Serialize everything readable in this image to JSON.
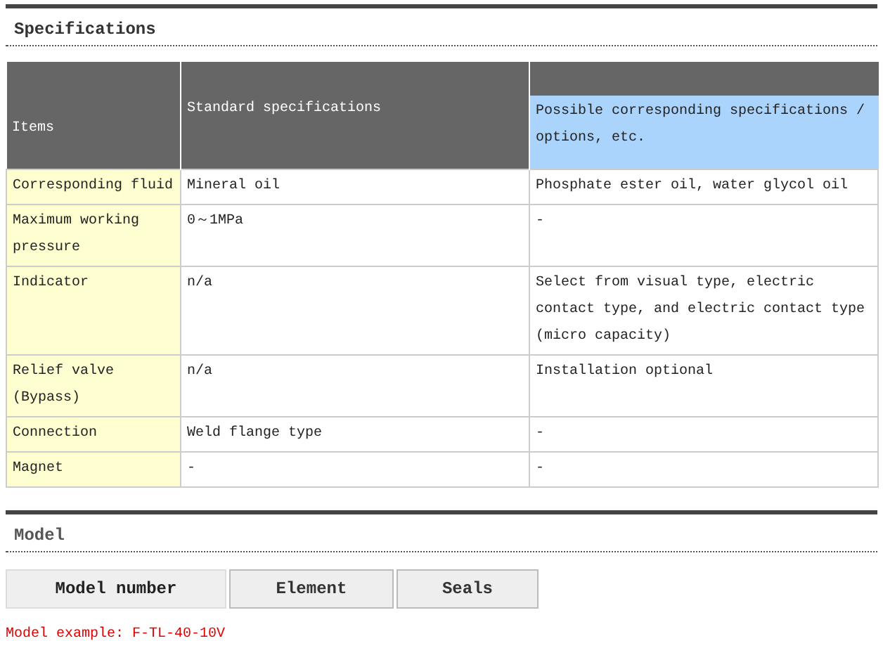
{
  "specifications": {
    "title": "Specifications",
    "table": {
      "columns": [
        {
          "label": "Items",
          "highlighted": false
        },
        {
          "label": "Standard specifications",
          "highlighted": false
        },
        {
          "label": "Possible corresponding specifications / options, etc.",
          "highlighted": true
        }
      ],
      "rows": [
        [
          "Corresponding fluid",
          "Mineral oil",
          "Phosphate ester oil, water glycol oil"
        ],
        [
          "Maximum working pressure",
          "0～1MPa",
          "-"
        ],
        [
          "Indicator",
          "n/a",
          "Select from visual type, electric contact type, and electric contact type (micro capacity)"
        ],
        [
          "Relief valve (Bypass)",
          "n/a",
          "Installation optional"
        ],
        [
          "Connection",
          "Weld flange type",
          "-"
        ],
        [
          "Magnet",
          "-",
          "-"
        ]
      ]
    }
  },
  "model": {
    "title": "Model",
    "tabs": [
      {
        "label": "Model number",
        "selected": true
      },
      {
        "label": "Element",
        "selected": false
      },
      {
        "label": "Seals",
        "selected": false
      }
    ],
    "example": "Model example: F-TL-40-10V"
  }
}
